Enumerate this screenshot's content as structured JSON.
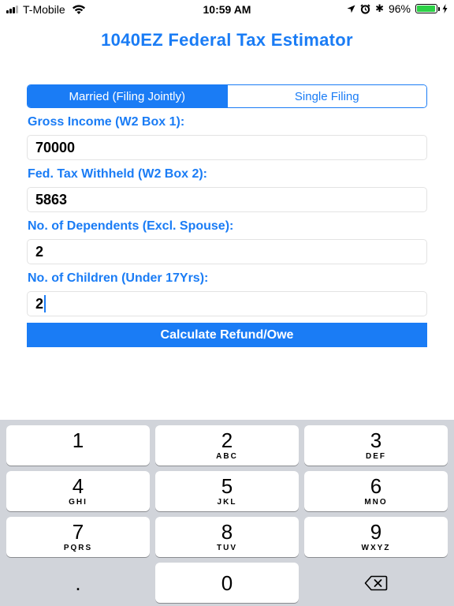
{
  "status_bar": {
    "carrier": "T-Mobile",
    "time": "10:59 AM",
    "battery_percent": "96%",
    "battery_level": 0.96,
    "battery_color": "#2bd146",
    "icons": [
      "signal-icon",
      "wifi-icon",
      "location-icon",
      "alarm-icon",
      "bluetooth-icon",
      "battery-icon",
      "charging-icon"
    ]
  },
  "app": {
    "title": "1040EZ Federal Tax Estimator",
    "accent_color": "#1a7cf5"
  },
  "filing_status": {
    "options": [
      "Married (Filing Jointly)",
      "Single Filing"
    ],
    "selected": "Married (Filing Jointly)"
  },
  "form": {
    "gross_income": {
      "label": "Gross Income (W2 Box 1):",
      "value": "70000"
    },
    "tax_withheld": {
      "label": "Fed. Tax Withheld (W2 Box 2):",
      "value": "5863"
    },
    "dependents": {
      "label": "No. of Dependents (Excl. Spouse):",
      "value": "2"
    },
    "children": {
      "label": "No. of Children (Under 17Yrs):",
      "value": "2"
    },
    "calculate_label": "Calculate Refund/Owe"
  },
  "keypad": {
    "keys": [
      {
        "digit": "1",
        "letters": ""
      },
      {
        "digit": "2",
        "letters": "ABC"
      },
      {
        "digit": "3",
        "letters": "DEF"
      },
      {
        "digit": "4",
        "letters": "GHI"
      },
      {
        "digit": "5",
        "letters": "JKL"
      },
      {
        "digit": "6",
        "letters": "MNO"
      },
      {
        "digit": "7",
        "letters": "PQRS"
      },
      {
        "digit": "8",
        "letters": "TUV"
      },
      {
        "digit": "9",
        "letters": "WXYZ"
      },
      {
        "digit": ".",
        "letters": ""
      },
      {
        "digit": "0",
        "letters": ""
      }
    ],
    "delete_icon": "backspace-icon"
  }
}
